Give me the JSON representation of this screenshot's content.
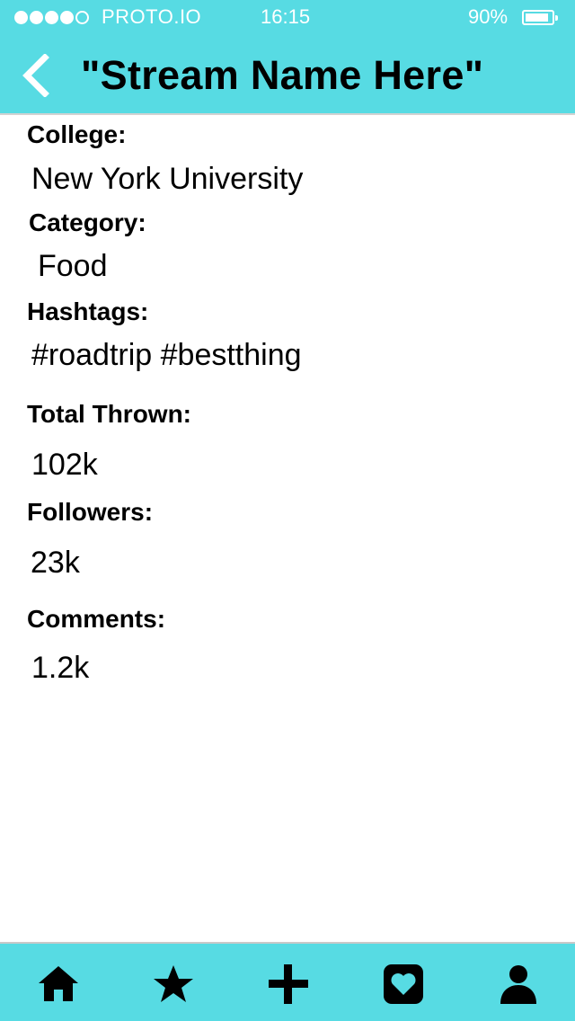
{
  "status_bar": {
    "carrier": "PROTO.IO",
    "time": "16:15",
    "battery": "90%",
    "battery_level": 0.9,
    "signal_bars": 4
  },
  "nav": {
    "title": "\"Stream Name Here\"",
    "back_icon": "chevron-left-icon"
  },
  "details": {
    "college_label": "College:",
    "college_value": "New York University",
    "category_label": "Category:",
    "category_value": "Food",
    "hashtags_label": "Hashtags:",
    "hashtags_value": "#roadtrip #bestthing",
    "total_thrown_label": "Total Thrown:",
    "total_thrown_value": "102k",
    "followers_label": "Followers:",
    "followers_value": "23k",
    "comments_label": "Comments:",
    "comments_value": "1.2k"
  },
  "tab_bar": {
    "items": [
      "home-icon",
      "star-icon",
      "plus-icon",
      "heart-box-icon",
      "profile-icon"
    ]
  },
  "colors": {
    "accent": "#57dbe3",
    "text": "#000000",
    "background": "#ffffff"
  }
}
